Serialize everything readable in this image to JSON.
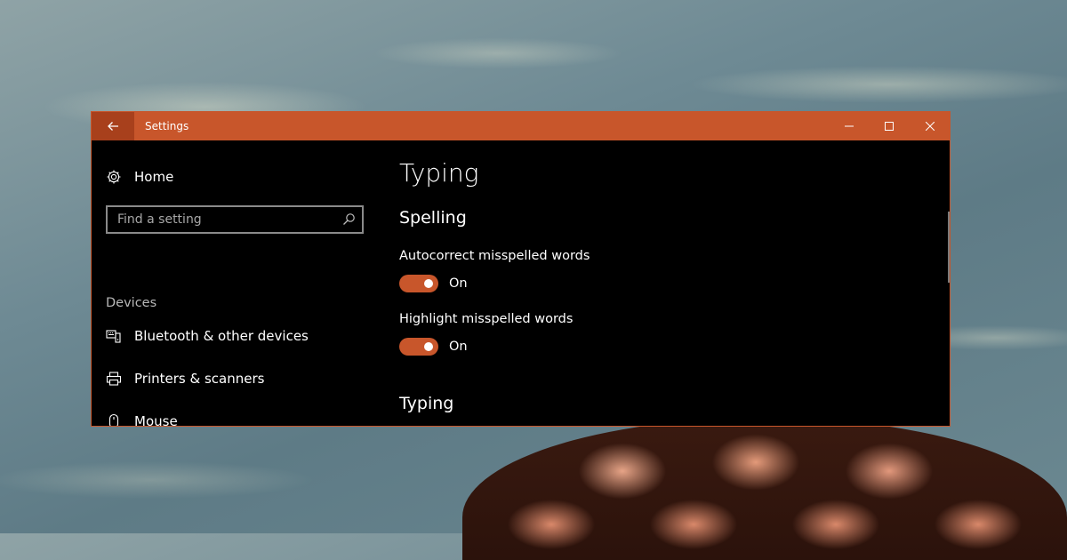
{
  "window": {
    "title": "Settings",
    "accent_color": "#c8562b",
    "back_icon": "back-arrow-icon",
    "controls": [
      "minimize-icon",
      "maximize-icon",
      "close-icon"
    ]
  },
  "sidebar": {
    "home": {
      "label": "Home",
      "icon": "gear-icon"
    },
    "search": {
      "placeholder": "Find a setting",
      "value": "",
      "icon": "search-icon"
    },
    "section_label": "Devices",
    "items": [
      {
        "label": "Bluetooth & other devices",
        "icon": "bluetooth-devices-icon"
      },
      {
        "label": "Printers & scanners",
        "icon": "printer-icon"
      },
      {
        "label": "Mouse",
        "icon": "mouse-icon"
      }
    ]
  },
  "content": {
    "page_title": "Typing",
    "spelling_heading": "Spelling",
    "settings": [
      {
        "label": "Autocorrect misspelled words",
        "state": "On"
      },
      {
        "label": "Highlight misspelled words",
        "state": "On"
      }
    ],
    "typing_heading": "Typing"
  }
}
